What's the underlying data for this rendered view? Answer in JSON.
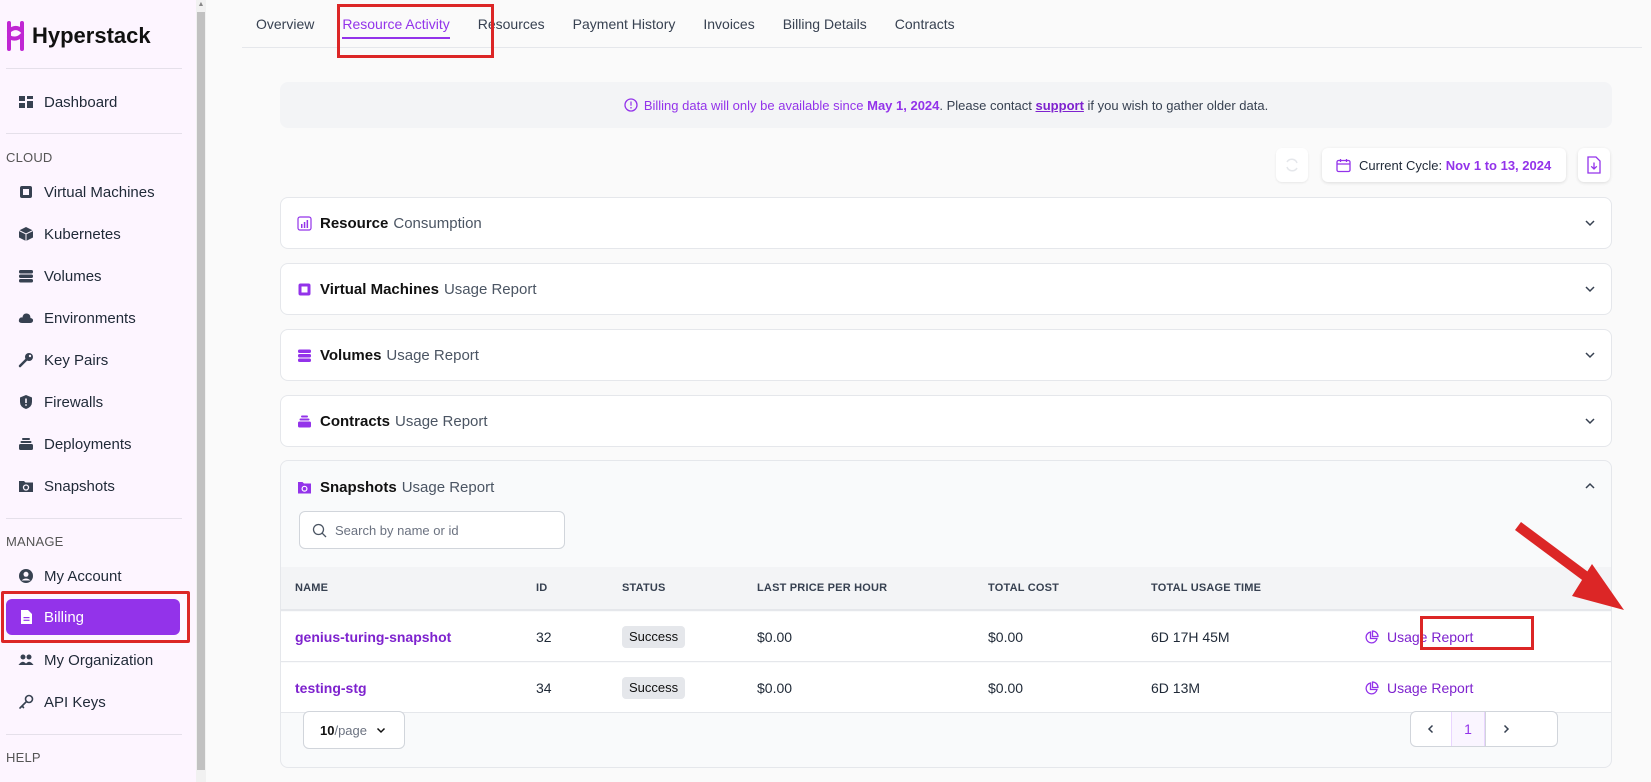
{
  "brand": {
    "name": "Hyperstack",
    "accent": "#9333ea",
    "highlight": "#dc2626"
  },
  "sidebar": {
    "dashboard": "Dashboard",
    "cloud_title": "CLOUD",
    "cloud_items": [
      {
        "label": "Virtual Machines",
        "icon": "cpu-icon"
      },
      {
        "label": "Kubernetes",
        "icon": "cube-icon"
      },
      {
        "label": "Volumes",
        "icon": "database-icon"
      },
      {
        "label": "Environments",
        "icon": "cloud-icon"
      },
      {
        "label": "Key Pairs",
        "icon": "key-icon"
      },
      {
        "label": "Firewalls",
        "icon": "shield-icon"
      },
      {
        "label": "Deployments",
        "icon": "layers-icon"
      },
      {
        "label": "Snapshots",
        "icon": "snapshot-folder-icon"
      }
    ],
    "manage_title": "MANAGE",
    "manage_items": [
      {
        "label": "My Account",
        "icon": "user-circle-icon"
      },
      {
        "label": "Billing",
        "icon": "document-icon"
      },
      {
        "label": "My Organization",
        "icon": "users-icon"
      },
      {
        "label": "API Keys",
        "icon": "key-outline-icon"
      }
    ],
    "help_title": "HELP"
  },
  "tabs": [
    "Overview",
    "Resource Activity",
    "Resources",
    "Payment History",
    "Invoices",
    "Billing Details",
    "Contracts"
  ],
  "notice": {
    "prefix": "Billing data will only be available since ",
    "date": "May 1, 2024",
    "middle": ". Please contact ",
    "link": "support",
    "suffix": " if you wish to gather older data."
  },
  "cycle": {
    "label": "Current Cycle: ",
    "value": "Nov 1 to 13, 2024"
  },
  "sections": [
    {
      "bold": "Resource",
      "rest": "Consumption"
    },
    {
      "bold": "Virtual Machines",
      "rest": "Usage Report"
    },
    {
      "bold": "Volumes",
      "rest": "Usage Report"
    },
    {
      "bold": "Contracts",
      "rest": "Usage Report"
    }
  ],
  "snapshots": {
    "bold": "Snapshots",
    "rest": "Usage Report",
    "search_placeholder": "Search by name or id",
    "columns": [
      "NAME",
      "ID",
      "STATUS",
      "LAST PRICE PER HOUR",
      "TOTAL COST",
      "TOTAL USAGE TIME"
    ],
    "rows": [
      {
        "name": "genius-turing-snapshot",
        "id": "32",
        "status": "Success",
        "price": "$0.00",
        "cost": "$0.00",
        "time": "6D 17H 45M",
        "action": "Usage Report"
      },
      {
        "name": "testing-stg",
        "id": "34",
        "status": "Success",
        "price": "$0.00",
        "cost": "$0.00",
        "time": "6D 13M",
        "action": "Usage Report"
      }
    ],
    "page_size": "10",
    "page_size_suffix": "/page",
    "current_page": "1"
  }
}
